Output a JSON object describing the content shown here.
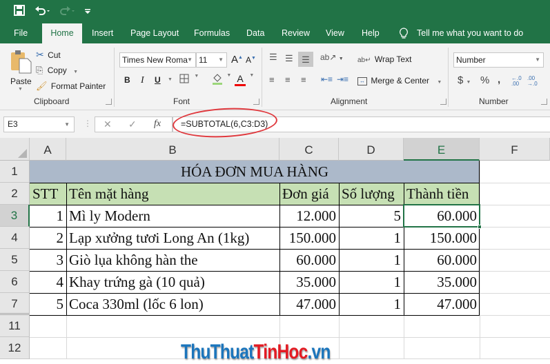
{
  "qat": {
    "save_icon": "save-icon",
    "undo_icon": "undo-icon",
    "redo_icon": "redo-icon",
    "customize_icon": "customize-qat-icon"
  },
  "tabs": [
    {
      "label": "File",
      "active": false
    },
    {
      "label": "Home",
      "active": true
    },
    {
      "label": "Insert",
      "active": false
    },
    {
      "label": "Page Layout",
      "active": false
    },
    {
      "label": "Formulas",
      "active": false
    },
    {
      "label": "Data",
      "active": false
    },
    {
      "label": "Review",
      "active": false
    },
    {
      "label": "View",
      "active": false
    },
    {
      "label": "Help",
      "active": false
    }
  ],
  "tell_me": "Tell me what you want to do",
  "ribbon": {
    "clipboard": {
      "label": "Clipboard",
      "paste": "Paste",
      "cut": "Cut",
      "copy": "Copy",
      "format_painter": "Format Painter"
    },
    "font": {
      "label": "Font",
      "font_name": "Times New Roma",
      "font_size": "11",
      "bold": "B",
      "italic": "I",
      "underline": "U",
      "font_color": "#ff0000",
      "fill_color": "#9bd67a"
    },
    "alignment": {
      "label": "Alignment",
      "wrap_text": "Wrap Text",
      "merge_center": "Merge & Center"
    },
    "number": {
      "label": "Number",
      "format": "Number",
      "currency": "$",
      "percent": "%",
      "comma": ","
    }
  },
  "formula_bar": {
    "name_box": "E3",
    "formula": "=SUBTOTAL(6,C3:D3)",
    "cancel": "✕",
    "enter": "✓",
    "fx": "fx"
  },
  "sheet": {
    "columns": [
      "A",
      "B",
      "C",
      "D",
      "E",
      "F"
    ],
    "selected_column": "E",
    "rows": [
      "1",
      "2",
      "3",
      "4",
      "5",
      "6",
      "7",
      "11",
      "12"
    ],
    "selected_row": "3",
    "title": "HÓA ĐƠN MUA HÀNG",
    "title_fill": "#acb9ca",
    "header_fill": "#c6e0b4",
    "headers": [
      "STT",
      "Tên mặt hàng",
      "Đơn giá",
      "Số lượng",
      "Thành tiền"
    ],
    "data": [
      [
        "1",
        "Mì ly Modern",
        "12.000",
        "5",
        "60.000"
      ],
      [
        "2",
        "Lạp xưởng tươi Long An (1kg)",
        "150.000",
        "1",
        "150.000"
      ],
      [
        "3",
        "Giò lụa không hàn the",
        "60.000",
        "1",
        "60.000"
      ],
      [
        "4",
        "Khay trứng gà (10 quả)",
        "35.000",
        "1",
        "35.000"
      ],
      [
        "5",
        "Coca 330ml (lốc 6 lon)",
        "47.000",
        "1",
        "47.000"
      ]
    ],
    "active_cell": "E3"
  },
  "watermark": {
    "part1": "ThuThuat",
    "part2": "TinHoc",
    "part3": ".vn"
  }
}
